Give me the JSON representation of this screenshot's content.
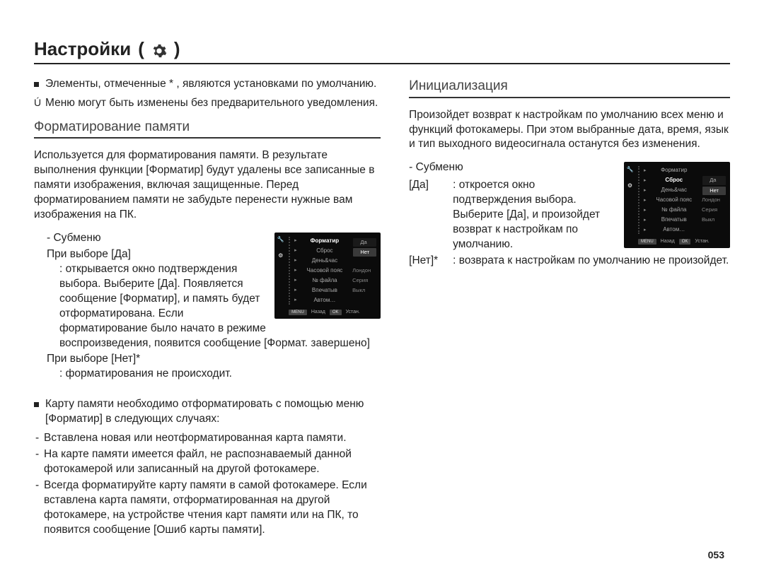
{
  "page_title_label": "Настройки",
  "page_title_paren_open": "(",
  "page_title_paren_close": ")",
  "gear_icon_name": "gear-icon",
  "left": {
    "bullet1": "Элементы, отмеченные * , являются установками по умолчанию.",
    "bullet2": "Меню могут быть изменены без предварительного уведомления.",
    "heading": "Форматирование памяти",
    "para1": "Используется для форматирования памяти. В результате выполнения функции [Форматир] будут удалены все записанные в памяти изображения, включая защищенные. Перед форматированием памяти не забудьте перенести нужные вам изображения на ПК.",
    "submenu_label": "- Субменю",
    "yes_sel": "При выборе [Да]",
    "yes_desc": ": открывается окно подтверждения выбора. Выберите [Да]. Появляется сообщение [Форматир], и память будет отформатирована. Если форматирование было начато в режиме воспроизведения, появится сообщение [Формат. завершено]",
    "no_sel": "При выборе [Нет]*",
    "no_desc": ": форматирования не происходит.",
    "bullet3_lead": "Карту памяти необходимо отформатировать с помощью меню [Форматир] в следующих случаях:",
    "case1": "Вставлена новая или неотформатированная карта памяти.",
    "case2": "На карте памяти имеется файл, не распознаваемый данной фотокамерой или записанный на другой фотокамере.",
    "case3": "Всегда форматируйте карту памяти в самой фотокамере. Если вставлена карта памяти, отформатированная на другой фотокамере, на устройстве чтения карт памяти или на ПК, то появится сообщение [Ошиб карты памяти].",
    "menu": {
      "rows": [
        {
          "l": "Форматир",
          "r": "",
          "hl": true
        },
        {
          "l": "Сброс",
          "r": ""
        },
        {
          "l": "День&час",
          "r": ""
        },
        {
          "l": "Часовой пояс",
          "r": "Лондон"
        },
        {
          "l": "№ файла",
          "r": "Серия"
        },
        {
          "l": "Впечатыв",
          "r": "Выкл"
        },
        {
          "l": "Автом…",
          "r": ""
        }
      ],
      "opts": {
        "yes": "Да",
        "no": "Нет"
      },
      "foot_back_btn": "MENU",
      "foot_back": "Назад",
      "foot_ok_btn": "OK",
      "foot_ok": "Устан."
    }
  },
  "right": {
    "heading": "Инициализация",
    "para1": "Произойдет возврат к настройкам по умолчанию всех меню и функций фотокамеры. При этом выбранные дата, время, язык и тип выходного видеосигнала останутся без изменения.",
    "submenu_label": "- Субменю",
    "yes_label": "[Да]",
    "yes_desc": ": откроется окно подтверждения выбора. Выберите [Да], и произойдет возврат к настройкам по умолчанию.",
    "no_label": "[Нет]*",
    "no_desc": ": возврата к настройкам по умолчанию не произойдет.",
    "menu": {
      "rows": [
        {
          "l": "Форматир",
          "r": ""
        },
        {
          "l": "Сброс",
          "r": "",
          "hl": true
        },
        {
          "l": "День&час",
          "r": ""
        },
        {
          "l": "Часовой пояс",
          "r": "Лондон"
        },
        {
          "l": "№ файла",
          "r": "Серия"
        },
        {
          "l": "Впечатыв",
          "r": "Выкл"
        },
        {
          "l": "Автом…",
          "r": ""
        }
      ],
      "opts": {
        "yes": "Да",
        "no": "Нет"
      },
      "foot_back_btn": "MENU",
      "foot_back": "Назад",
      "foot_ok_btn": "OK",
      "foot_ok": "Устан."
    }
  },
  "page_number": "053"
}
